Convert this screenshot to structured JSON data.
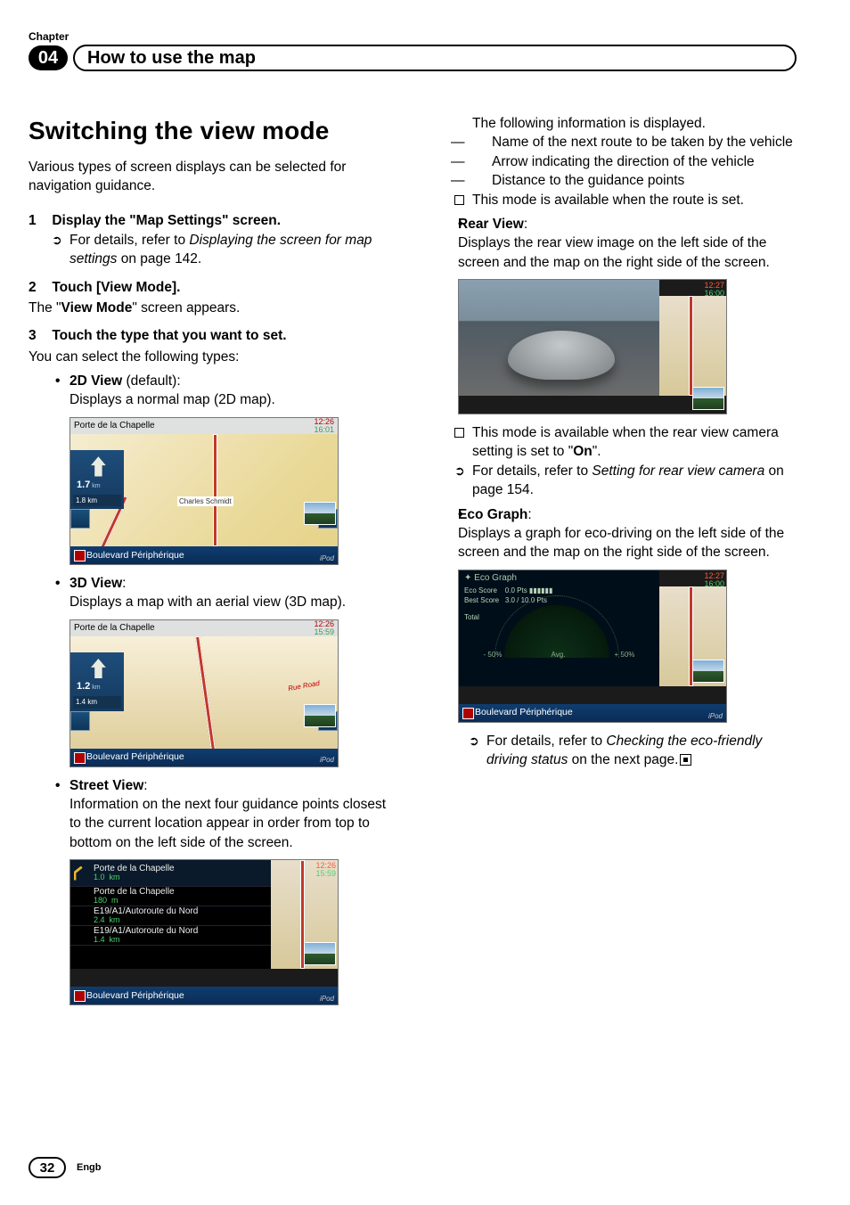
{
  "chapter_label": "Chapter",
  "chapter_number": "04",
  "chapter_title": "How to use the map",
  "section_title": "Switching the view mode",
  "intro": "Various types of screen displays can be selected for navigation guidance.",
  "steps": {
    "s1": {
      "num": "1",
      "title": "Display the \"Map Settings\" screen."
    },
    "s1_ref": "For details, refer to ",
    "s1_ref_i": "Displaying the screen for map settings",
    "s1_ref_tail": " on page 142.",
    "s2": {
      "num": "2",
      "title": "Touch [View Mode]."
    },
    "s2_body_a": "The \"",
    "s2_body_b": "View Mode",
    "s2_body_c": "\" screen appears.",
    "s3": {
      "num": "3",
      "title": "Touch the type that you want to set."
    },
    "s3_body": "You can select the following types:"
  },
  "types": {
    "t2d": {
      "name": "2D View",
      "suffix": " (default):",
      "desc": "Displays a normal map (2D map)."
    },
    "t3d": {
      "name": "3D View",
      "suffix": ":",
      "desc": "Displays a map with an aerial view (3D map)."
    },
    "tsv": {
      "name": "Street View",
      "suffix": ":",
      "desc": "Information on the next four guidance points closest to the current location appear in order from top to bottom on the left side of the screen."
    },
    "trv": {
      "name": "Rear View",
      "suffix": ":",
      "desc": "Displays the rear view image on the left side of the screen and the map on the right side of the screen."
    },
    "teg": {
      "name": "Eco Graph",
      "suffix": ":",
      "desc": "Displays a graph for eco-driving on the left side of the screen and the map on the right side of the screen."
    }
  },
  "right_col": {
    "disp_intro": "The following information is displayed.",
    "dash1": "Name of the next route to be taken by the vehicle",
    "dash2": "Arrow indicating the direction of the vehicle",
    "dash3": "Distance to the guidance points",
    "note_route": "This mode is available when the route is set.",
    "rear_note_a": "This mode is available when the rear view camera setting is set to \"",
    "rear_note_b": "On",
    "rear_note_c": "\".",
    "rear_ref_a": "For details, refer to ",
    "rear_ref_i": "Setting for rear view camera",
    "rear_ref_tail": " on page 154.",
    "eco_ref_a": "For details, refer to ",
    "eco_ref_i": "Checking the eco-friendly driving status",
    "eco_ref_tail": " on the next page."
  },
  "fig": {
    "chapelle": "Porte de la Chapelle",
    "road": "Boulevard Périphérique",
    "t1": "12:26",
    "t2": "16:01",
    "t2b": "15:59",
    "t1b": "12:27",
    "t2c": "16:00",
    "d2d": "1.7",
    "d2d_sub": "1.8",
    "d3d": "1.2",
    "d3d_sub": "1.4",
    "km": "km",
    "sv_d1": "1.0",
    "sv_d2": "180",
    "sv_d2u": "m",
    "sv_r3": "E19/A1/Autoroute du Nord",
    "sv_d3": "2.4",
    "sv_d4": "1.4",
    "eco_title": "Eco Graph",
    "eco_score": "Eco Score",
    "eco_best": "Best Score",
    "eco_pts1": "0.0 Pts",
    "eco_pts2": "3.0 / 10.0 Pts",
    "eco_total": "Total",
    "eco_neg": "- 50%",
    "eco_avg": "Avg.",
    "eco_pos": "+ 50%",
    "ipod": "iPod",
    "schmidt": "Charles Schmidt",
    "rueroad": "Rue Road"
  },
  "footer": {
    "page": "32",
    "lang": "Engb"
  }
}
